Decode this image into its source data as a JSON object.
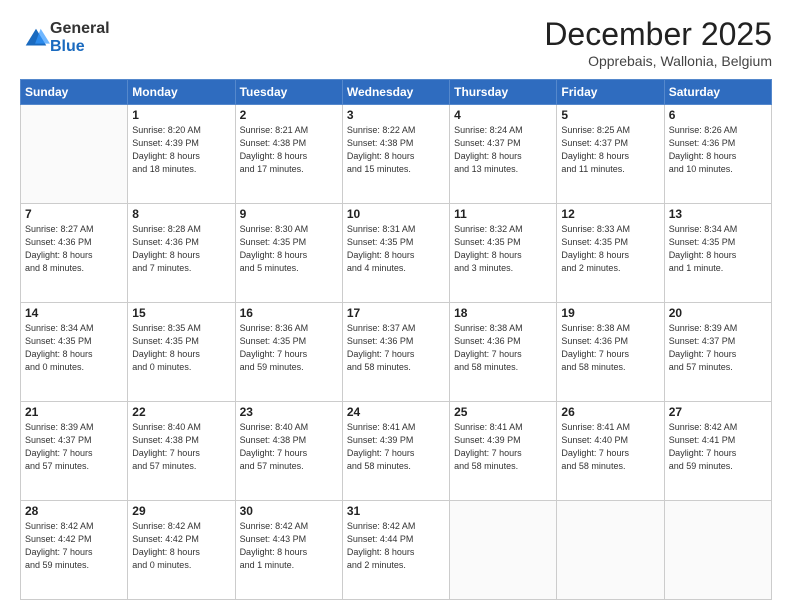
{
  "header": {
    "logo_general": "General",
    "logo_blue": "Blue",
    "month_title": "December 2025",
    "location": "Opprebais, Wallonia, Belgium"
  },
  "days_of_week": [
    "Sunday",
    "Monday",
    "Tuesday",
    "Wednesday",
    "Thursday",
    "Friday",
    "Saturday"
  ],
  "weeks": [
    [
      {
        "day": "",
        "info": ""
      },
      {
        "day": "1",
        "info": "Sunrise: 8:20 AM\nSunset: 4:39 PM\nDaylight: 8 hours\nand 18 minutes."
      },
      {
        "day": "2",
        "info": "Sunrise: 8:21 AM\nSunset: 4:38 PM\nDaylight: 8 hours\nand 17 minutes."
      },
      {
        "day": "3",
        "info": "Sunrise: 8:22 AM\nSunset: 4:38 PM\nDaylight: 8 hours\nand 15 minutes."
      },
      {
        "day": "4",
        "info": "Sunrise: 8:24 AM\nSunset: 4:37 PM\nDaylight: 8 hours\nand 13 minutes."
      },
      {
        "day": "5",
        "info": "Sunrise: 8:25 AM\nSunset: 4:37 PM\nDaylight: 8 hours\nand 11 minutes."
      },
      {
        "day": "6",
        "info": "Sunrise: 8:26 AM\nSunset: 4:36 PM\nDaylight: 8 hours\nand 10 minutes."
      }
    ],
    [
      {
        "day": "7",
        "info": "Sunrise: 8:27 AM\nSunset: 4:36 PM\nDaylight: 8 hours\nand 8 minutes."
      },
      {
        "day": "8",
        "info": "Sunrise: 8:28 AM\nSunset: 4:36 PM\nDaylight: 8 hours\nand 7 minutes."
      },
      {
        "day": "9",
        "info": "Sunrise: 8:30 AM\nSunset: 4:35 PM\nDaylight: 8 hours\nand 5 minutes."
      },
      {
        "day": "10",
        "info": "Sunrise: 8:31 AM\nSunset: 4:35 PM\nDaylight: 8 hours\nand 4 minutes."
      },
      {
        "day": "11",
        "info": "Sunrise: 8:32 AM\nSunset: 4:35 PM\nDaylight: 8 hours\nand 3 minutes."
      },
      {
        "day": "12",
        "info": "Sunrise: 8:33 AM\nSunset: 4:35 PM\nDaylight: 8 hours\nand 2 minutes."
      },
      {
        "day": "13",
        "info": "Sunrise: 8:34 AM\nSunset: 4:35 PM\nDaylight: 8 hours\nand 1 minute."
      }
    ],
    [
      {
        "day": "14",
        "info": "Sunrise: 8:34 AM\nSunset: 4:35 PM\nDaylight: 8 hours\nand 0 minutes."
      },
      {
        "day": "15",
        "info": "Sunrise: 8:35 AM\nSunset: 4:35 PM\nDaylight: 8 hours\nand 0 minutes."
      },
      {
        "day": "16",
        "info": "Sunrise: 8:36 AM\nSunset: 4:35 PM\nDaylight: 7 hours\nand 59 minutes."
      },
      {
        "day": "17",
        "info": "Sunrise: 8:37 AM\nSunset: 4:36 PM\nDaylight: 7 hours\nand 58 minutes."
      },
      {
        "day": "18",
        "info": "Sunrise: 8:38 AM\nSunset: 4:36 PM\nDaylight: 7 hours\nand 58 minutes."
      },
      {
        "day": "19",
        "info": "Sunrise: 8:38 AM\nSunset: 4:36 PM\nDaylight: 7 hours\nand 58 minutes."
      },
      {
        "day": "20",
        "info": "Sunrise: 8:39 AM\nSunset: 4:37 PM\nDaylight: 7 hours\nand 57 minutes."
      }
    ],
    [
      {
        "day": "21",
        "info": "Sunrise: 8:39 AM\nSunset: 4:37 PM\nDaylight: 7 hours\nand 57 minutes."
      },
      {
        "day": "22",
        "info": "Sunrise: 8:40 AM\nSunset: 4:38 PM\nDaylight: 7 hours\nand 57 minutes."
      },
      {
        "day": "23",
        "info": "Sunrise: 8:40 AM\nSunset: 4:38 PM\nDaylight: 7 hours\nand 57 minutes."
      },
      {
        "day": "24",
        "info": "Sunrise: 8:41 AM\nSunset: 4:39 PM\nDaylight: 7 hours\nand 58 minutes."
      },
      {
        "day": "25",
        "info": "Sunrise: 8:41 AM\nSunset: 4:39 PM\nDaylight: 7 hours\nand 58 minutes."
      },
      {
        "day": "26",
        "info": "Sunrise: 8:41 AM\nSunset: 4:40 PM\nDaylight: 7 hours\nand 58 minutes."
      },
      {
        "day": "27",
        "info": "Sunrise: 8:42 AM\nSunset: 4:41 PM\nDaylight: 7 hours\nand 59 minutes."
      }
    ],
    [
      {
        "day": "28",
        "info": "Sunrise: 8:42 AM\nSunset: 4:42 PM\nDaylight: 7 hours\nand 59 minutes."
      },
      {
        "day": "29",
        "info": "Sunrise: 8:42 AM\nSunset: 4:42 PM\nDaylight: 8 hours\nand 0 minutes."
      },
      {
        "day": "30",
        "info": "Sunrise: 8:42 AM\nSunset: 4:43 PM\nDaylight: 8 hours\nand 1 minute."
      },
      {
        "day": "31",
        "info": "Sunrise: 8:42 AM\nSunset: 4:44 PM\nDaylight: 8 hours\nand 2 minutes."
      },
      {
        "day": "",
        "info": ""
      },
      {
        "day": "",
        "info": ""
      },
      {
        "day": "",
        "info": ""
      }
    ]
  ]
}
